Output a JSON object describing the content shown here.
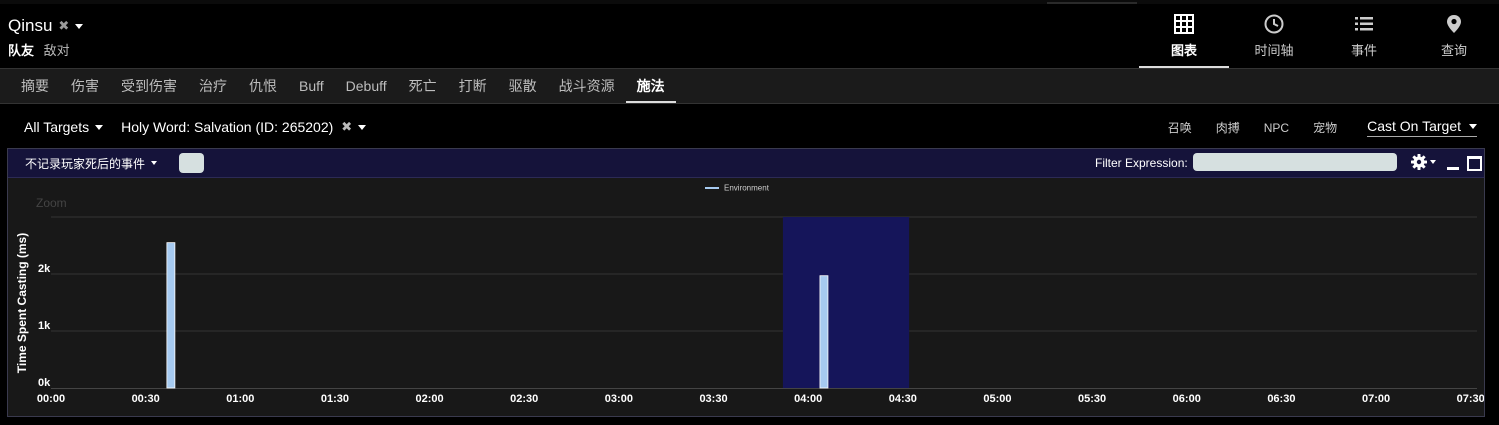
{
  "header": {
    "player_name": "Qinsu",
    "ally_label": "队友",
    "enemy_label": "敌对"
  },
  "topnav": [
    {
      "label": "图表",
      "icon": "grid-icon",
      "active": true
    },
    {
      "label": "时间轴",
      "icon": "clock-icon",
      "active": false
    },
    {
      "label": "事件",
      "icon": "list-icon",
      "active": false
    },
    {
      "label": "查询",
      "icon": "map-pin-icon",
      "active": false
    }
  ],
  "tabs": [
    "摘要",
    "伤害",
    "受到伤害",
    "治疗",
    "仇恨",
    "Buff",
    "Debuff",
    "死亡",
    "打断",
    "驱散",
    "战斗资源",
    "施法"
  ],
  "active_tab": "施法",
  "filters": {
    "targets": "All Targets",
    "ability": "Holy Word: Salvation (ID: 265202)",
    "options": [
      "召唤",
      "肉搏",
      "NPC",
      "宠物"
    ],
    "cast_mode": "Cast On Target"
  },
  "panel": {
    "death_filter": "不记录玩家死后的事件",
    "filter_label": "Filter Expression:",
    "filter_value": "",
    "zoom_label": "Zoom"
  },
  "colors": {
    "bar": "#a6caf0",
    "highlight": "#15155a",
    "header_bg": "#15133a"
  },
  "chart_data": {
    "type": "bar",
    "ylabel": "Time Spent Casting (ms)",
    "xlabel": "",
    "legend": [
      "Environment"
    ],
    "legend_position": "top-center",
    "grid": true,
    "x_unit": "seconds",
    "x_ticks": [
      "00:00",
      "00:30",
      "01:00",
      "01:30",
      "02:00",
      "02:30",
      "03:00",
      "03:30",
      "04:00",
      "04:30",
      "05:00",
      "05:30",
      "06:00",
      "06:30",
      "07:00",
      "07:30"
    ],
    "y_ticks": [
      "0k",
      "1k",
      "2k"
    ],
    "xlim": [
      0,
      452
    ],
    "ylim": [
      0,
      3000
    ],
    "highlight_range": [
      232,
      272
    ],
    "series": [
      {
        "name": "Environment",
        "points": [
          {
            "x": 38,
            "y": 2550
          },
          {
            "x": 245,
            "y": 1970
          }
        ]
      }
    ]
  }
}
